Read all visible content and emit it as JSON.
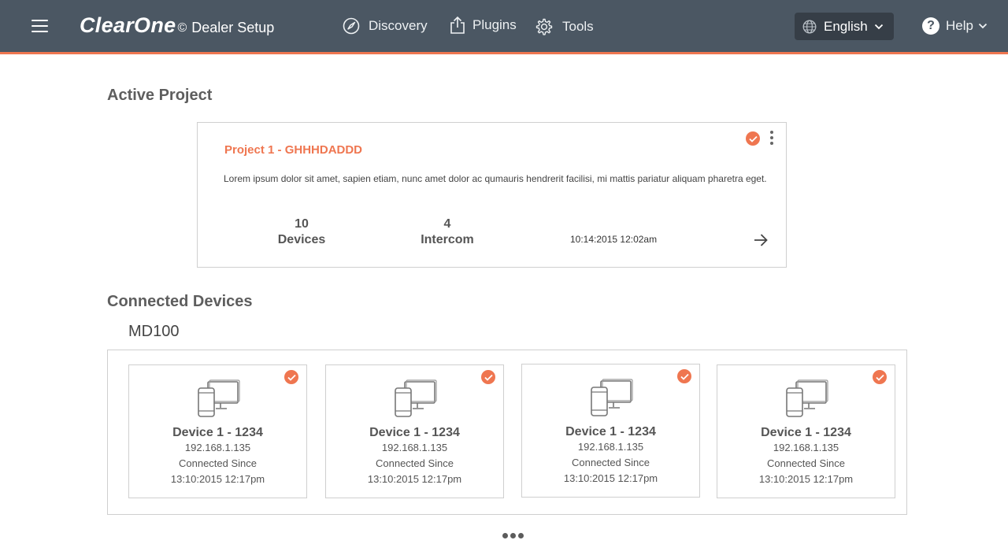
{
  "header": {
    "brand": "ClearOne",
    "brand_mark": "©",
    "app_name": "Dealer Setup",
    "nav": [
      {
        "label": "Discovery",
        "icon": "compass-icon"
      },
      {
        "label": "Plugins",
        "icon": "upload-icon"
      },
      {
        "label": "Tools",
        "icon": "gear-icon"
      }
    ],
    "language": "English",
    "help": "Help"
  },
  "active_project": {
    "section_title": "Active Project",
    "name": "Project 1 - GHHHDADDD",
    "description": "Lorem ipsum dolor sit amet, sapien etiam, nunc amet dolor ac qumauris hendrerit facilisi, mi mattis pariatur aliquam pharetra eget.",
    "devices_count": "10",
    "devices_label": "Devices",
    "intercom_count": "4",
    "intercom_label": "Intercom",
    "timestamp": "10:14:2015 12:02am"
  },
  "connected_devices": {
    "section_title": "Connected Devices",
    "group_title": "MD100",
    "devices": [
      {
        "name": "Device 1 - 1234",
        "ip": "192.168.1.135",
        "since_label": "Connected Since",
        "since": "13:10:2015 12:17pm"
      },
      {
        "name": "Device 1 - 1234",
        "ip": "192.168.1.135",
        "since_label": "Connected Since",
        "since": "13:10:2015 12:17pm"
      },
      {
        "name": "Device 1 - 1234",
        "ip": "192.168.1.135",
        "since_label": "Connected Since",
        "since": "13:10:2015 12:17pm"
      },
      {
        "name": "Device 1 - 1234",
        "ip": "192.168.1.135",
        "since_label": "Connected Since",
        "since": "13:10:2015 12:17pm"
      }
    ]
  },
  "colors": {
    "header_bg": "#4b5763",
    "accent": "#ef7650",
    "language_bg": "#363e47"
  }
}
